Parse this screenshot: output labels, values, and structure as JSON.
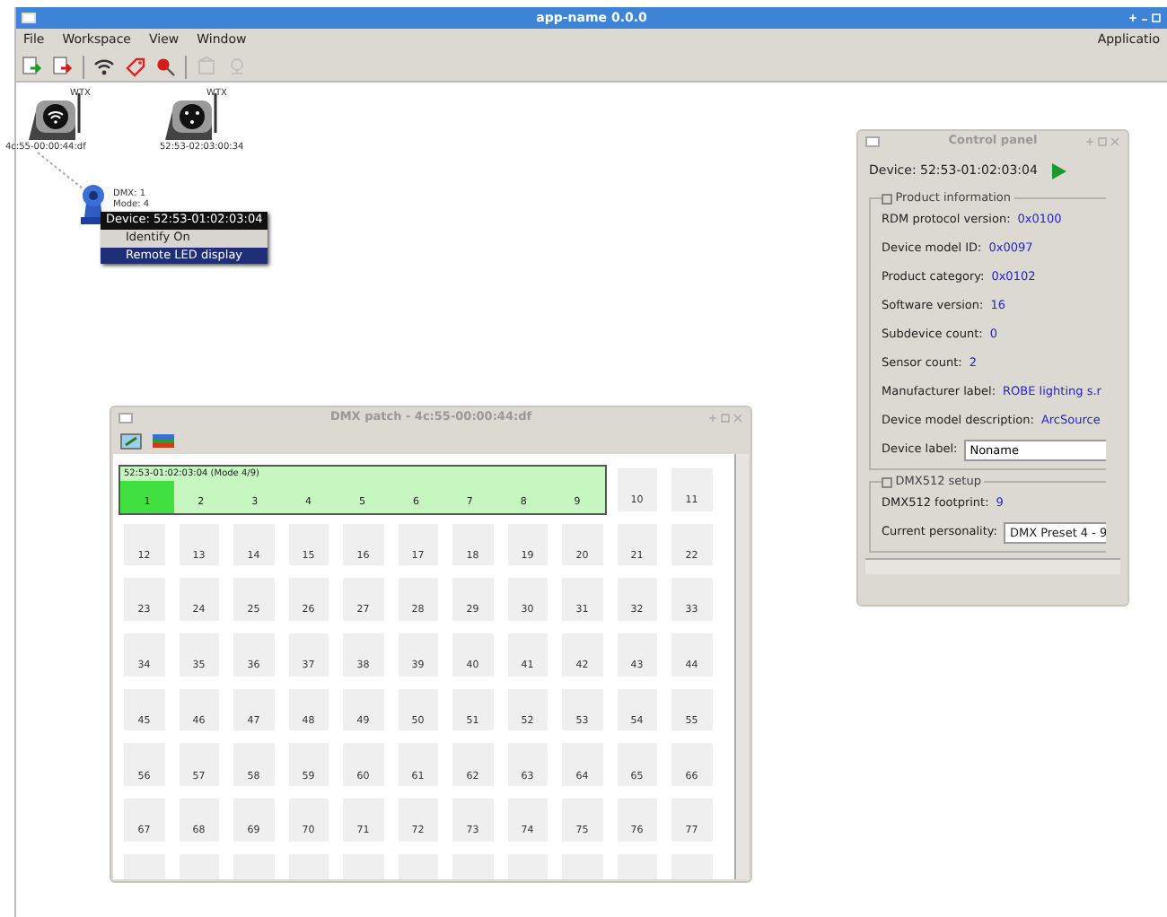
{
  "window": {
    "title": "app-name 0.0.0"
  },
  "menu": [
    "File",
    "Workspace",
    "View",
    "Window"
  ],
  "menu_right": "Applicatio",
  "toolbar": [
    {
      "disabled": false
    },
    {
      "disabled": false
    },
    {
      "disabled": false
    },
    {
      "disabled": false
    },
    {
      "disabled": false
    },
    {
      "disabled": true
    },
    {
      "disabled": true
    }
  ],
  "gateways": [
    {
      "kind": "wireless",
      "name": "WTX",
      "address": "4c:55-00:00:44:df"
    },
    {
      "kind": "wired",
      "name": "WTX",
      "address": "52:53-02:03:00:34"
    }
  ],
  "fixture": {
    "dmx": "DMX: 1",
    "mode": "Mode: 4"
  },
  "context_menu": {
    "header": "Device: 52:53-01:02:03:04",
    "items": [
      {
        "label": "Identify On",
        "selected": false
      },
      {
        "label": "Remote LED display",
        "selected": true
      }
    ]
  },
  "control_panel": {
    "title": "Control panel",
    "device": "Device: 52:53-01:02:03:04",
    "groups": [
      {
        "title": "Product information",
        "fields": [
          {
            "kind": "text",
            "label": "RDM protocol version:",
            "value": "0x0100"
          },
          {
            "kind": "text",
            "label": "Device model ID:",
            "value": "0x0097"
          },
          {
            "kind": "text",
            "label": "Product category:",
            "value": "0x0102"
          },
          {
            "kind": "text",
            "label": "Software version:",
            "value": "16"
          },
          {
            "kind": "text",
            "label": "Subdevice count:",
            "value": "0"
          },
          {
            "kind": "text",
            "label": "Sensor count:",
            "value": "2"
          },
          {
            "kind": "text",
            "label": "Manufacturer label:",
            "value": "ROBE lighting s.r"
          },
          {
            "kind": "text",
            "label": "Device model description:",
            "value": "ArcSource"
          },
          {
            "kind": "input",
            "label": "Device label:",
            "value": "Noname"
          }
        ]
      },
      {
        "title": "DMX512 setup",
        "fields": [
          {
            "kind": "text",
            "label": "DMX512 footprint:",
            "value": "9"
          },
          {
            "kind": "select",
            "label": "Current personality:",
            "value": "DMX Preset 4 - 9"
          }
        ]
      }
    ]
  },
  "dmx_patch": {
    "title": "DMX patch - 4c:55-00:00:44:df",
    "device_label": "52:53-01:02:03:04 (Mode 4/9)",
    "channels": [
      {
        "number": "1",
        "selected": true
      },
      {
        "number": "2",
        "selected": false
      },
      {
        "number": "3",
        "selected": false
      },
      {
        "number": "4",
        "selected": false
      },
      {
        "number": "5",
        "selected": false
      },
      {
        "number": "6",
        "selected": false
      },
      {
        "number": "7",
        "selected": false
      },
      {
        "number": "8",
        "selected": false
      },
      {
        "number": "9",
        "selected": false
      }
    ],
    "free_slots": [
      "10",
      "11",
      "12",
      "13",
      "14",
      "15",
      "16",
      "17",
      "18",
      "19",
      "20",
      "21",
      "22",
      "23",
      "24",
      "25",
      "26",
      "27",
      "28",
      "29",
      "30",
      "31",
      "32",
      "33",
      "34",
      "35",
      "36",
      "37",
      "38",
      "39",
      "40",
      "41",
      "42",
      "43",
      "44",
      "45",
      "46",
      "47",
      "48",
      "49",
      "50",
      "51",
      "52",
      "53",
      "54",
      "55",
      "56",
      "57",
      "58",
      "59",
      "60",
      "61",
      "62",
      "63",
      "64",
      "65",
      "66",
      "67",
      "68",
      "69",
      "70",
      "71",
      "72",
      "73",
      "74",
      "75",
      "76",
      "77"
    ]
  }
}
